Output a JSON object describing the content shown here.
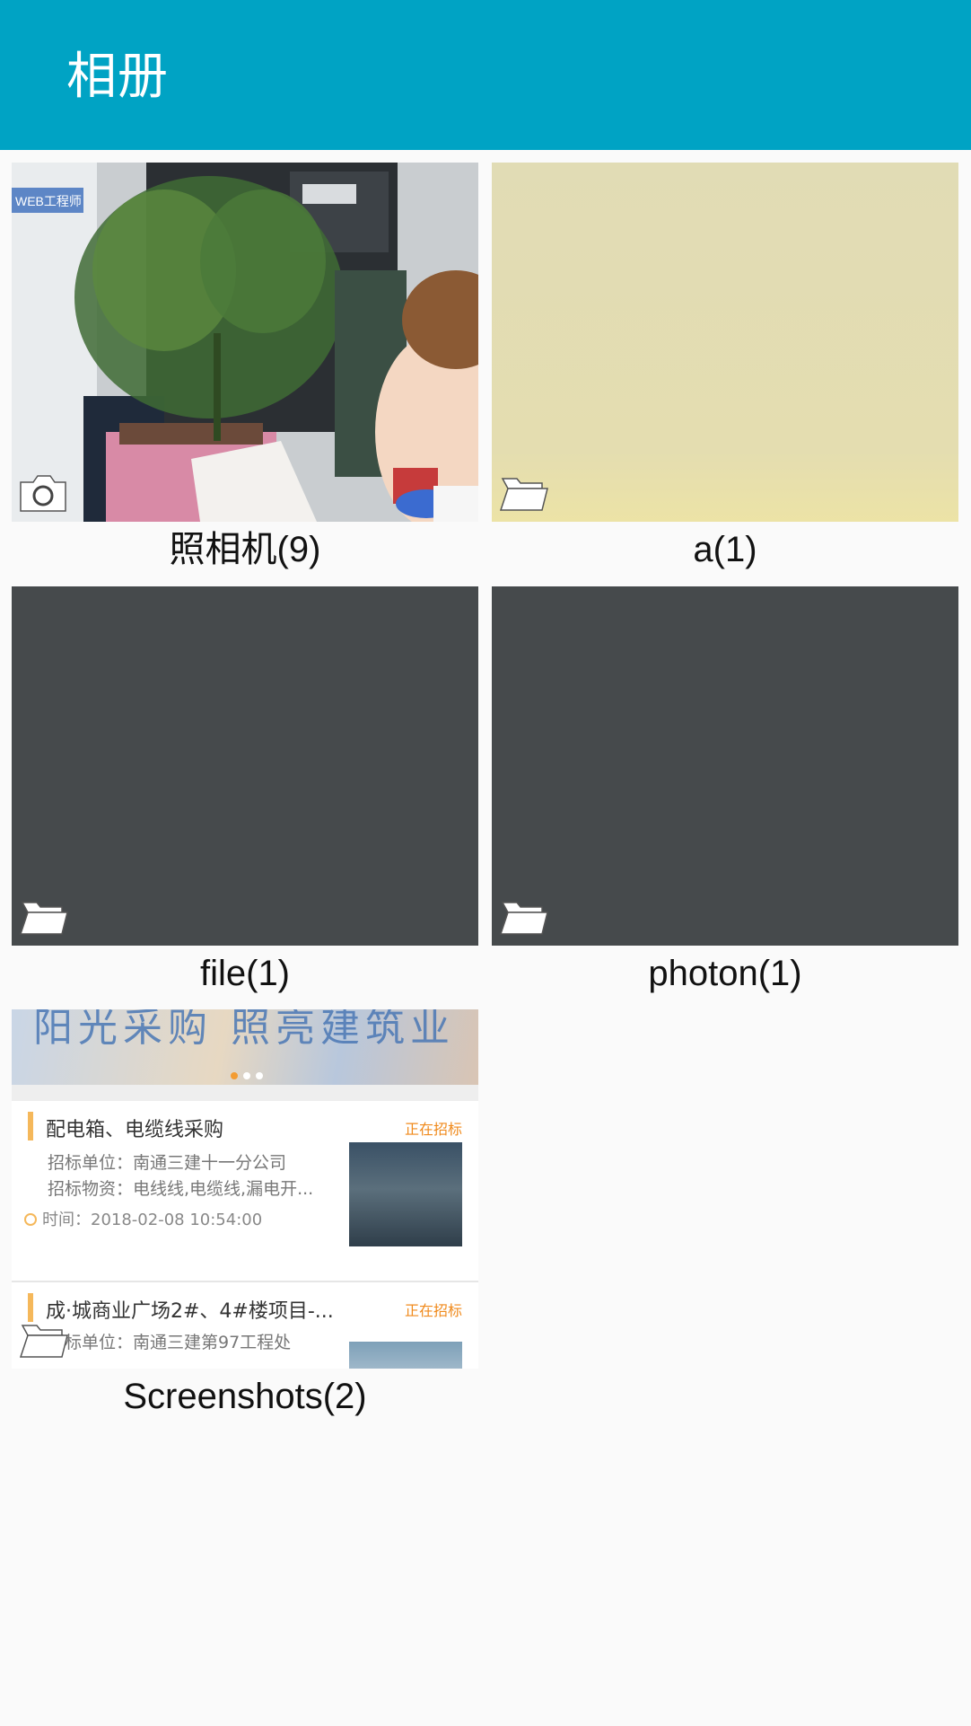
{
  "appbar": {
    "title": "相册"
  },
  "albums": [
    {
      "name": "照相机(9)",
      "badge": "camera-icon"
    },
    {
      "name": "a(1)",
      "badge": "folder-icon"
    },
    {
      "name": "file(1)",
      "badge": "folder-icon"
    },
    {
      "name": "photon(1)",
      "badge": "folder-icon"
    },
    {
      "name": "Screenshots(2)",
      "badge": "folder-icon"
    }
  ],
  "colors": {
    "appbar": "#00a3c4",
    "background": "#fafafa",
    "album_a": "#e2dcb5",
    "album_dark": "#464a4c"
  },
  "screenshot_preview": {
    "banner_text": "阳光采购 照亮建筑业",
    "items": [
      {
        "title": "配电箱、电缆线采购",
        "tag": "正在招标",
        "line1": "招标单位：南通三建十一分公司",
        "line2": "招标物资：电线线,电缆线,漏电开...",
        "time": "时间：2018-02-08 10:54:00"
      },
      {
        "title": "成·城商业广场2#、4#楼项目-...",
        "tag": "正在招标",
        "line1": "招标单位：南通三建第97工程处"
      }
    ]
  }
}
